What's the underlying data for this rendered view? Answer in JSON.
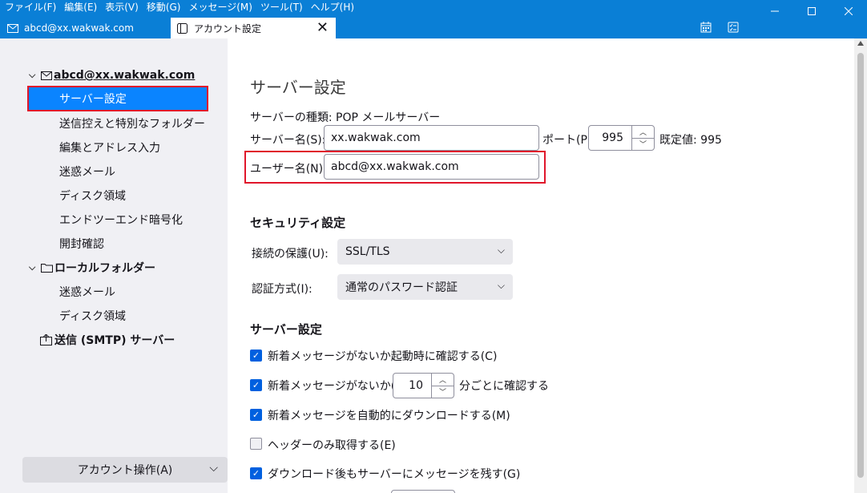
{
  "menu": [
    "ファイル(F)",
    "編集(E)",
    "表示(V)",
    "移動(G)",
    "メッセージ(M)",
    "ツール(T)",
    "ヘルプ(H)"
  ],
  "tabs": {
    "mail_tab": "abcd@xx.wakwak.com",
    "settings_tab": "アカウント設定"
  },
  "sidebar": {
    "account": "abcd@xx.wakwak.com",
    "account_items": [
      "サーバー設定",
      "送信控えと特別なフォルダー",
      "編集とアドレス入力",
      "迷惑メール",
      "ディスク領域",
      "エンドツーエンド暗号化",
      "開封確認"
    ],
    "local_folders": "ローカルフォルダー",
    "local_items": [
      "迷惑メール",
      "ディスク領域"
    ],
    "smtp": "送信 (SMTP) サーバー",
    "account_actions": "アカウント操作(A)"
  },
  "main": {
    "title": "サーバー設定",
    "server_type": "サーバーの種類: POP メールサーバー",
    "server_name_label": "サーバー名(S):",
    "server_name": "xx.wakwak.com",
    "port_label": "ポート(P):",
    "port": "995",
    "default_port": "既定値: 995",
    "username_label": "ユーザー名(N):",
    "username": "abcd@xx.wakwak.com",
    "security_heading": "セキュリティ設定",
    "connection_label": "接続の保護(U):",
    "connection_value": "SSL/TLS",
    "auth_label": "認証方式(I):",
    "auth_value": "通常のパスワード認証",
    "server_settings_heading": "サーバー設定",
    "check_on_startup": "新着メッセージがないか起動時に確認する(C)",
    "check_every_prefix": "新着メッセージがないか(Y)",
    "check_every_value": "10",
    "check_every_suffix": "分ごとに確認する",
    "auto_download": "新着メッセージを自動的にダウンロードする(M)",
    "headers_only": "ヘッダーのみ取得する(E)",
    "leave_on_server": "ダウンロード後もサーバーにメッセージを残す(G)"
  },
  "colors": {
    "accent": "#0a84ff",
    "titlebar": "#0a7fd6",
    "highlight_box": "#e0162b"
  }
}
